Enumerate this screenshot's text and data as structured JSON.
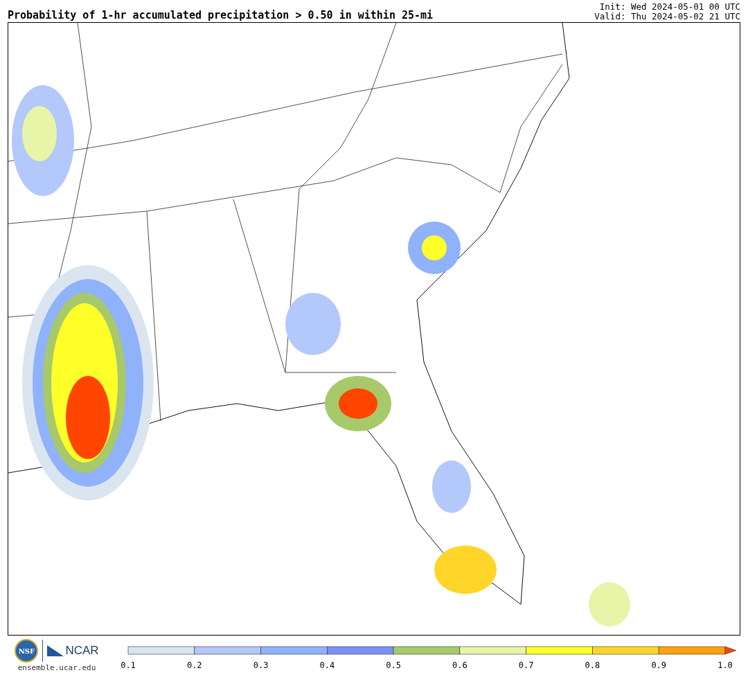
{
  "header": {
    "title": "Probability of 1-hr accumulated precipitation > 0.50 in within 25-mi",
    "init": "Init: Wed 2024-05-01 00 UTC",
    "valid": "Valid: Thu 2024-05-02 21 UTC"
  },
  "footer": {
    "nsf_logo": "NSF",
    "ncar_logo": "NCAR",
    "site": "ensemble.ucar.edu"
  },
  "colorbar": {
    "bins": [
      {
        "color": "#dbe5ef"
      },
      {
        "color": "#b3c9fb"
      },
      {
        "color": "#8fb2fb"
      },
      {
        "color": "#7d90f7"
      },
      {
        "color": "#a7c96a"
      },
      {
        "color": "#e8f5a8"
      },
      {
        "color": "#ffff2a"
      },
      {
        "color": "#ffd52a"
      },
      {
        "color": "#ffa210"
      },
      {
        "color": "#ff4500",
        "kind": "arrow"
      }
    ],
    "ticks": [
      "0.1",
      "0.2",
      "0.3",
      "0.4",
      "0.5",
      "0.6",
      "0.7",
      "0.8",
      "0.9",
      "1.0"
    ]
  }
}
